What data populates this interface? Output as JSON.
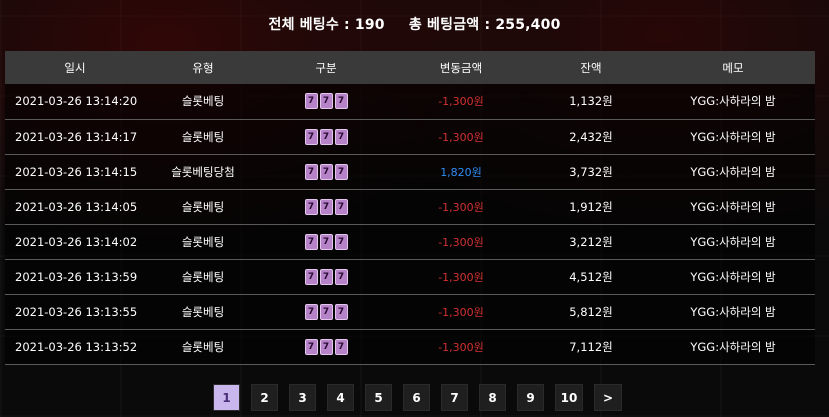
{
  "summary": {
    "bet_count_label": "전체 베팅수 :",
    "bet_count": "190",
    "bet_amount_label": "총 베팅금액 :",
    "bet_amount": "255,400"
  },
  "table": {
    "headers": [
      "일시",
      "유형",
      "구분",
      "변동금액",
      "잔액",
      "메모"
    ],
    "slot_icon": "slot-machine-icon",
    "rows": [
      {
        "date": "2021-03-26 13:14:20",
        "type": "슬롯베팅",
        "change": "-1,300원",
        "change_kind": "neg",
        "balance": "1,132원",
        "memo": "YGG:사하라의 밤"
      },
      {
        "date": "2021-03-26 13:14:17",
        "type": "슬롯베팅",
        "change": "-1,300원",
        "change_kind": "neg",
        "balance": "2,432원",
        "memo": "YGG:사하라의 밤"
      },
      {
        "date": "2021-03-26 13:14:15",
        "type": "슬롯베팅당첨",
        "change": "1,820원",
        "change_kind": "pos",
        "balance": "3,732원",
        "memo": "YGG:사하라의 밤"
      },
      {
        "date": "2021-03-26 13:14:05",
        "type": "슬롯베팅",
        "change": "-1,300원",
        "change_kind": "neg",
        "balance": "1,912원",
        "memo": "YGG:사하라의 밤"
      },
      {
        "date": "2021-03-26 13:14:02",
        "type": "슬롯베팅",
        "change": "-1,300원",
        "change_kind": "neg",
        "balance": "3,212원",
        "memo": "YGG:사하라의 밤"
      },
      {
        "date": "2021-03-26 13:13:59",
        "type": "슬롯베팅",
        "change": "-1,300원",
        "change_kind": "neg",
        "balance": "4,512원",
        "memo": "YGG:사하라의 밤"
      },
      {
        "date": "2021-03-26 13:13:55",
        "type": "슬롯베팅",
        "change": "-1,300원",
        "change_kind": "neg",
        "balance": "5,812원",
        "memo": "YGG:사하라의 밤"
      },
      {
        "date": "2021-03-26 13:13:52",
        "type": "슬롯베팅",
        "change": "-1,300원",
        "change_kind": "neg",
        "balance": "7,112원",
        "memo": "YGG:사하라의 밤"
      }
    ]
  },
  "pagination": {
    "pages": [
      "1",
      "2",
      "3",
      "4",
      "5",
      "6",
      "7",
      "8",
      "9",
      "10"
    ],
    "active": "1",
    "next_label": ">"
  },
  "colors": {
    "negative": "#d23131",
    "positive": "#2d8df5",
    "active_page": "#c9b6ec",
    "header_bg": "#3a3a3a"
  }
}
